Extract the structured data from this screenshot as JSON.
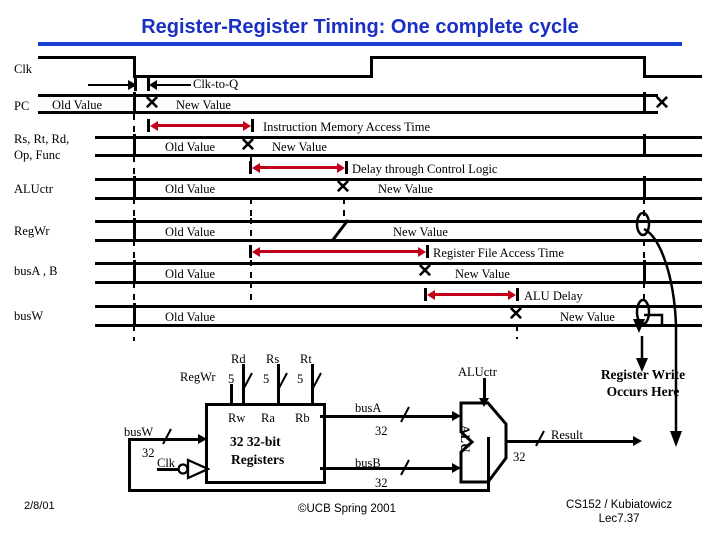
{
  "title": "Register-Register Timing: One complete cycle",
  "accent_color": "#1a2fc4",
  "arrow_color": "#c20019",
  "waveform": {
    "rows": [
      {
        "label": "Clk"
      },
      {
        "label": "PC",
        "old": "Old Value",
        "new": "New Value"
      },
      {
        "label_line1": "Rs, Rt, Rd,",
        "label_line2": "Op, Func",
        "old": "Old Value",
        "new": "New Value"
      },
      {
        "label": "ALUctr",
        "old": "Old Value",
        "new": "New Value"
      },
      {
        "label": "RegWr",
        "old": "Old Value",
        "new": "New Value"
      },
      {
        "label": "busA , B",
        "old": "Old Value",
        "new": "New Value"
      },
      {
        "label": "busW",
        "old": "Old Value",
        "new": "New Value"
      }
    ],
    "annotations": [
      {
        "name": "clk-to-q",
        "text": "Clk-to-Q"
      },
      {
        "name": "imem-access",
        "text": "Instruction Memory Access Time"
      },
      {
        "name": "control-delay",
        "text": "Delay through Control Logic"
      },
      {
        "name": "regfile-access",
        "text": "Register File Access Time"
      },
      {
        "name": "alu-delay",
        "text": "ALU Delay"
      }
    ]
  },
  "datapath": {
    "regwr": "RegWr",
    "rd": "Rd",
    "rs": "Rs",
    "rt": "Rt",
    "width5_a": "5",
    "width5_b": "5",
    "width5_c": "5",
    "rw": "Rw",
    "ra": "Ra",
    "rb": "Rb",
    "regfile_line1": "32  32-bit",
    "regfile_line2": "Registers",
    "busw": "busW",
    "busw_width": "32",
    "clk": "Clk",
    "busa": "busA",
    "busa_width": "32",
    "busb": "busB",
    "busb_width": "32",
    "aluctr": "ALUctr",
    "alu": "ALU",
    "result": "Result",
    "result_width": "32",
    "register_write_note_line1": "Register Write",
    "register_write_note_line2": "Occurs Here"
  },
  "footer": {
    "date": "2/8/01",
    "copyright": "©UCB Spring 2001",
    "credit_line1": "CS152 / Kubiatowicz",
    "credit_line2": "Lec7.37"
  }
}
